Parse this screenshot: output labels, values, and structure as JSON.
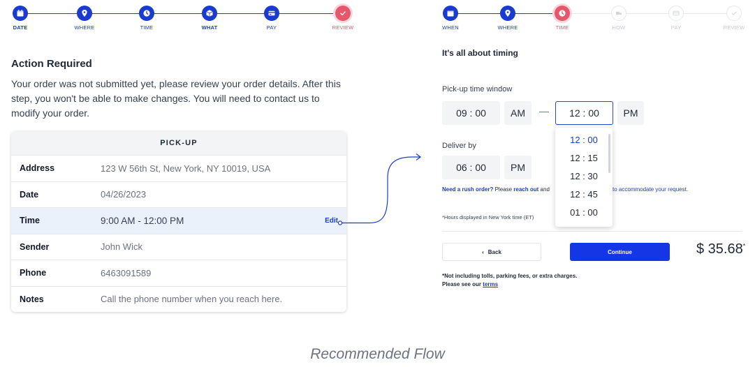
{
  "colors": {
    "accent": "#1a3bd0",
    "current_step": "#e5576a",
    "continue_bg": "#1536e5",
    "highlight_row": "#eaf1fb"
  },
  "left_stepper": {
    "steps": [
      {
        "label": "DATE",
        "icon": "calendar-icon",
        "state": "done"
      },
      {
        "label": "WHERE",
        "icon": "location-pin-icon",
        "state": "done"
      },
      {
        "label": "TIME",
        "icon": "clock-icon",
        "state": "done"
      },
      {
        "label": "WHAT",
        "icon": "package-icon",
        "state": "done"
      },
      {
        "label": "PAY",
        "icon": "credit-card-icon",
        "state": "done"
      },
      {
        "label": "REVIEW",
        "icon": "check-icon",
        "state": "current"
      }
    ]
  },
  "left": {
    "title": "Action Required",
    "message": "Your order was not submitted yet, please review your order details. After this step, you won't be able to make changes. You will need to contact us to modify your order.",
    "card": {
      "heading": "PICK-UP",
      "edit_label": "Edit",
      "rows": [
        {
          "key": "Address",
          "value": "123 W 56th St, New York, NY 10019, USA"
        },
        {
          "key": "Date",
          "value": "04/26/2023"
        },
        {
          "key": "Time",
          "value": "9:00 AM - 12:00 PM"
        },
        {
          "key": "Sender",
          "value": "John Wick"
        },
        {
          "key": "Phone",
          "value": "6463091589"
        },
        {
          "key": "Notes",
          "value": "Call the phone number when you reach here."
        }
      ]
    }
  },
  "right_stepper": {
    "steps": [
      {
        "label": "WHEN",
        "icon": "calendar-icon",
        "state": "done"
      },
      {
        "label": "WHERE",
        "icon": "location-pin-icon",
        "state": "done"
      },
      {
        "label": "TIME",
        "icon": "clock-icon",
        "state": "current"
      },
      {
        "label": "HOW",
        "icon": "truck-icon",
        "state": "todo"
      },
      {
        "label": "PAY",
        "icon": "credit-card-icon",
        "state": "todo"
      },
      {
        "label": "REVIEW",
        "icon": "check-icon",
        "state": "todo"
      }
    ]
  },
  "right": {
    "title": "It's all about timing",
    "pickup_label": "Pick-up time window",
    "pickup_start": "09 : 00",
    "pickup_start_period": "AM",
    "range_separator": "—",
    "pickup_end": "12 : 00",
    "pickup_end_period": "PM",
    "dropdown_options": [
      "12 : 00",
      "12 : 15",
      "12 : 30",
      "12 : 45",
      "01 : 00"
    ],
    "dropdown_selected": "12 : 00",
    "deliver_label": "Deliver by",
    "deliver_time": "06 : 00",
    "deliver_period": "PM",
    "rush_question": "Need a rush order?",
    "rush_text_a": "Please",
    "rush_link": "reach out",
    "rush_text_b": "and",
    "rush_tail": "to accommodate your request.",
    "hours_note": "*Hours displayed in New York time (ET)",
    "back_label": "Back",
    "continue_label": "Continue",
    "price": "$ 35.68",
    "price_mark": "*",
    "footnote_line1": "*Not including tolls, parking fees, or extra charges.",
    "footnote_line2": "Please see our",
    "terms_link": "terms"
  },
  "caption": "Recommended Flow"
}
